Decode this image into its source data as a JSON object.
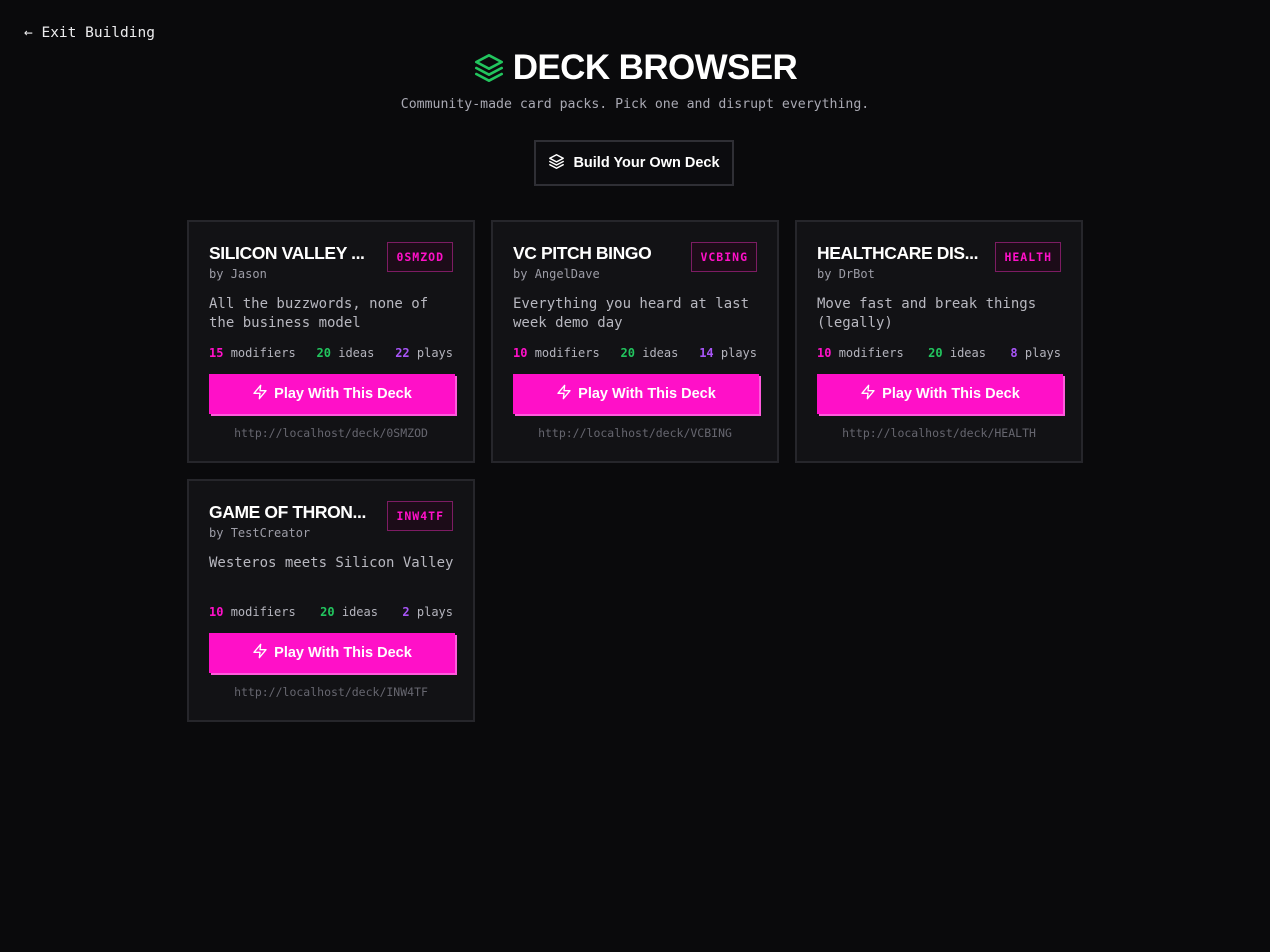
{
  "nav": {
    "exit_label": "← Exit Building"
  },
  "header": {
    "title": "DECK BROWSER",
    "subtitle": "Community-made card packs. Pick one and disrupt everything.",
    "icon": "layers-icon",
    "icon_color": "#22c55e"
  },
  "build_button": {
    "label": "Build Your Own Deck",
    "icon": "layers-icon"
  },
  "colors": {
    "accent": "#ff10c8",
    "modifiers": "#ff10c8",
    "ideas": "#22c55e",
    "plays": "#a855f7",
    "background": "#0a0a0c"
  },
  "decks": [
    {
      "title": "SILICON VALLEY ...",
      "code": "0SMZOD",
      "by_label": "by",
      "author": "Jason",
      "description": "All the buzzwords, none of the business model",
      "modifiers": "15",
      "modifiers_label": "modifiers",
      "ideas": "20",
      "ideas_label": "ideas",
      "plays": "22",
      "plays_label": "plays",
      "play_label": "Play With This Deck",
      "url": "http://localhost/deck/0SMZOD"
    },
    {
      "title": "VC PITCH BINGO",
      "code": "VCBING",
      "by_label": "by",
      "author": "AngelDave",
      "description": "Everything you heard at last week demo day",
      "modifiers": "10",
      "modifiers_label": "modifiers",
      "ideas": "20",
      "ideas_label": "ideas",
      "plays": "14",
      "plays_label": "plays",
      "play_label": "Play With This Deck",
      "url": "http://localhost/deck/VCBING"
    },
    {
      "title": "HEALTHCARE DIS...",
      "code": "HEALTH",
      "by_label": "by",
      "author": "DrBot",
      "description": "Move fast and break things (legally)",
      "modifiers": "10",
      "modifiers_label": "modifiers",
      "ideas": "20",
      "ideas_label": "ideas",
      "plays": "8",
      "plays_label": "plays",
      "play_label": "Play With This Deck",
      "url": "http://localhost/deck/HEALTH"
    },
    {
      "title": "GAME OF THRON...",
      "code": "INW4TF",
      "by_label": "by",
      "author": "TestCreator",
      "description": "Westeros meets Silicon Valley",
      "modifiers": "10",
      "modifiers_label": "modifiers",
      "ideas": "20",
      "ideas_label": "ideas",
      "plays": "2",
      "plays_label": "plays",
      "play_label": "Play With This Deck",
      "url": "http://localhost/deck/INW4TF"
    }
  ]
}
